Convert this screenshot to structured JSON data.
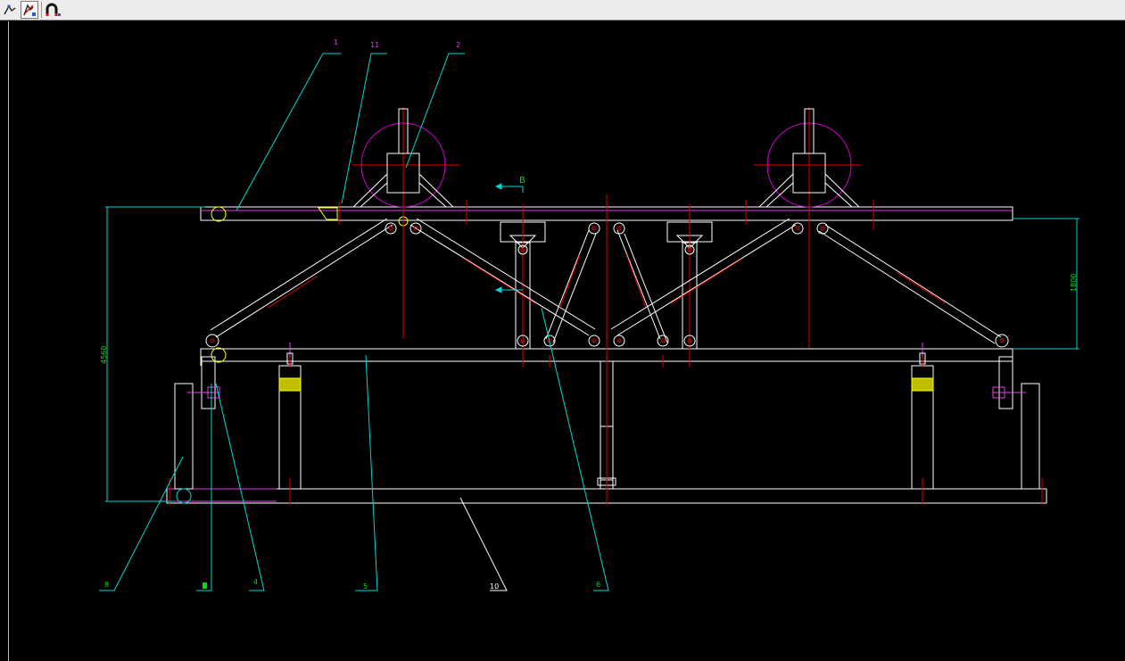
{
  "toolbar": {
    "buttons": [
      {
        "name": "select-tool-icon"
      },
      {
        "name": "draw-tool-icon"
      },
      {
        "name": "magnet-snap-icon"
      }
    ]
  },
  "drawing": {
    "callouts": {
      "c1": "1",
      "c11": "11",
      "c2": "2",
      "c8": "8",
      "c4": "4",
      "c5": "5",
      "c10": "10",
      "c6": "6"
    },
    "section_marker": "B",
    "dim_height_left": "4560",
    "dim_height_right": "1800"
  },
  "colors": {
    "background": "#000000",
    "outline": "#ffffff",
    "leader": "#00d6d6",
    "center_line": "#e00000",
    "wheel": "#d000d0",
    "label_magenta": "#e040e0",
    "label_green": "#00e000",
    "highlight": "#ffff00"
  }
}
